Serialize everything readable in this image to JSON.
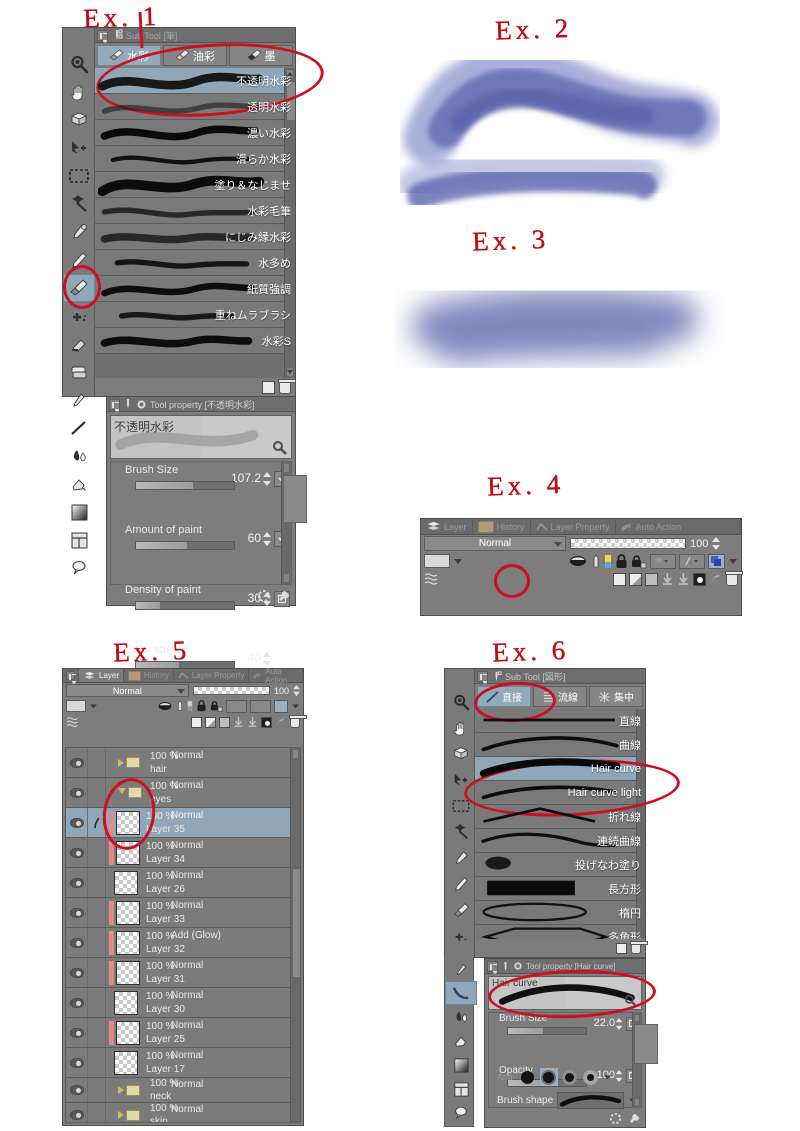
{
  "app": "Clip Studio Paint",
  "annotations": [
    {
      "id": "ex1",
      "text": "Ex. 1"
    },
    {
      "id": "ex2",
      "text": "Ex. 2"
    },
    {
      "id": "ex3",
      "text": "Ex. 3"
    },
    {
      "id": "ex4",
      "text": "Ex. 4"
    },
    {
      "id": "ex5",
      "text": "Ex. 5"
    },
    {
      "id": "ex6",
      "text": "Ex. 6"
    }
  ],
  "colors": {
    "panel_bg": "#7d7d7d",
    "panel_border": "#4e4e4e",
    "selection_blue": "#8fa7b8",
    "annotation_red": "#cc1020",
    "brush_stroke_blue": "#6670b5",
    "layer_red_marker": "#e08a8a"
  },
  "ex1": {
    "subtool_panel": {
      "title": "Sub Tool [筆]",
      "categories": [
        {
          "label": "水彩",
          "icon": "brush-water-icon",
          "active": true
        },
        {
          "label": "油彩",
          "icon": "brush-oil-icon",
          "active": false
        },
        {
          "label": "墨",
          "icon": "brush-ink-icon",
          "active": false
        }
      ],
      "items": [
        {
          "label": "不透明水彩",
          "selected": true
        },
        {
          "label": "透明水彩",
          "selected": false
        },
        {
          "label": "濃い水彩",
          "selected": false
        },
        {
          "label": "滑らか水彩",
          "selected": false
        },
        {
          "label": "塗り＆なじませ",
          "selected": false
        },
        {
          "label": "水彩毛筆",
          "selected": false
        },
        {
          "label": "にじみ縁水彩",
          "selected": false
        },
        {
          "label": "水多め",
          "selected": false
        },
        {
          "label": "紙質強調",
          "selected": false
        },
        {
          "label": "重ねムラブラシ",
          "selected": false
        },
        {
          "label": "水彩S",
          "selected": false
        }
      ]
    },
    "tool_property": {
      "title": "Tool property [不透明水彩]",
      "preview_label": "不透明水彩",
      "rows": [
        {
          "name": "Brush Size",
          "value": "107.2",
          "fill": 58,
          "button": "down-arrow-round-icon"
        },
        {
          "name": "Amount of paint",
          "value": "60",
          "fill": 52,
          "button": "down-arrow-round-icon"
        },
        {
          "name": "Density of paint",
          "value": "30",
          "fill": 24,
          "button": "square-icon"
        },
        {
          "name": "Color stretch",
          "value": "40",
          "fill": 44,
          "button": ""
        }
      ]
    },
    "toolbar_icons": [
      "magnifier-icon",
      "hand-icon",
      "rotate-canvas-icon",
      "move-layer-icon",
      "marquee-icon",
      "magic-wand-icon",
      "eyedropper-icon",
      "pen-icon",
      "brush-icon",
      "airbrush-icon",
      "eraser-icon",
      "blend-icon",
      "eyedropper2-icon",
      "figure-icon",
      "fill-icon",
      "gradient-icon",
      "frame-icon",
      "balloon-icon",
      "decoration-icon"
    ]
  },
  "ex2": {
    "caption": "Ex. 2",
    "stroke_color": "#6670b5"
  },
  "ex3": {
    "caption": "Ex. 3",
    "stroke_color": "#5d68ab"
  },
  "ex4": {
    "tabs": [
      {
        "label": "Layer",
        "icon": "layer-icon",
        "active": true
      },
      {
        "label": "History",
        "icon": "history-icon",
        "active": false
      },
      {
        "label": "Layer Property",
        "icon": "layer-property-icon",
        "active": false
      },
      {
        "label": "Auto Action",
        "icon": "auto-action-icon",
        "active": false
      }
    ],
    "blend_mode": "Normal",
    "opacity": "100",
    "row2_icons": [
      "color-swatch-dropdown",
      "clip-to-layer-icon",
      "mask-icon",
      "ruler-icon",
      "lock-icon",
      "lock-transparent-icon",
      "reference-layer-icon",
      "draft-layer-icon",
      "palette-color-icon"
    ],
    "row3_icons": [
      "new-raster-layer-icon",
      "new-tonal-layer-icon",
      "new-folder-icon",
      "transfer-down-icon",
      "combine-down-icon",
      "layer-mask-icon",
      "clip-icon",
      "delete-layer-icon"
    ],
    "highlighted_icon": "clip-to-layer-below-icon"
  },
  "ex5": {
    "tabs": [
      {
        "label": "Layer",
        "active": true
      },
      {
        "label": "History",
        "active": false
      },
      {
        "label": "Layer Property",
        "active": false
      },
      {
        "label": "Auto Action",
        "active": false
      }
    ],
    "blend_mode": "Normal",
    "opacity": "100",
    "layers": [
      {
        "opacity": "100 %",
        "blend": "Normal",
        "name": "hair",
        "type": "folder",
        "expanded": false,
        "selected": false,
        "red_marker": false
      },
      {
        "opacity": "100 %",
        "blend": "Normal",
        "name": "eyes",
        "type": "folder",
        "expanded": true,
        "selected": false,
        "red_marker": false
      },
      {
        "opacity": "100 %",
        "blend": "Normal",
        "name": "Layer 35",
        "type": "raster",
        "selected": true,
        "red_marker": true,
        "indent": true,
        "has_pen": true
      },
      {
        "opacity": "100 %",
        "blend": "Normal",
        "name": "Layer 34",
        "type": "raster",
        "selected": false,
        "red_marker": true,
        "indent": true
      },
      {
        "opacity": "100 %",
        "blend": "Normal",
        "name": "Layer 26",
        "type": "raster",
        "selected": false,
        "red_marker": false,
        "indent": true
      },
      {
        "opacity": "100 %",
        "blend": "Normal",
        "name": "Layer 33",
        "type": "raster",
        "selected": false,
        "red_marker": true,
        "indent": true
      },
      {
        "opacity": "100 %",
        "blend": "Add (Glow)",
        "name": "Layer 32",
        "type": "raster",
        "selected": false,
        "red_marker": true,
        "indent": true
      },
      {
        "opacity": "100 %",
        "blend": "Normal",
        "name": "Layer 31",
        "type": "raster",
        "selected": false,
        "red_marker": true,
        "indent": true
      },
      {
        "opacity": "100 %",
        "blend": "Normal",
        "name": "Layer 30",
        "type": "raster",
        "selected": false,
        "red_marker": false,
        "indent": true
      },
      {
        "opacity": "100 %",
        "blend": "Normal",
        "name": "Layer 25",
        "type": "raster",
        "selected": false,
        "red_marker": true,
        "indent": true
      },
      {
        "opacity": "100 %",
        "blend": "Normal",
        "name": "Layer 17",
        "type": "raster",
        "selected": false,
        "red_marker": false,
        "indent": true
      },
      {
        "opacity": "100 %",
        "blend": "Normal",
        "name": "neck",
        "type": "folder",
        "expanded": false,
        "selected": false,
        "red_marker": false
      },
      {
        "opacity": "100 %",
        "blend": "Normal",
        "name": "skin",
        "type": "folder",
        "expanded": false,
        "selected": false,
        "red_marker": false
      }
    ]
  },
  "ex6": {
    "subtool_panel": {
      "title": "Sub Tool [図形]",
      "categories": [
        {
          "label": "直接",
          "icon": "straight-line-icon",
          "active": true
        },
        {
          "label": "流線",
          "icon": "flow-line-icon",
          "active": false
        },
        {
          "label": "集中",
          "icon": "focus-line-icon",
          "active": false
        }
      ],
      "items": [
        {
          "label": "直線",
          "selected": false
        },
        {
          "label": "曲線",
          "selected": false
        },
        {
          "label": "Hair curve",
          "selected": true
        },
        {
          "label": "Hair curve light",
          "selected": false
        },
        {
          "label": "折れ線",
          "selected": false
        },
        {
          "label": "連続曲線",
          "selected": false
        },
        {
          "label": "投げなわ塗り",
          "selected": false
        },
        {
          "label": "長方形",
          "selected": false
        },
        {
          "label": "楕円",
          "selected": false
        },
        {
          "label": "多角形",
          "selected": false
        }
      ]
    },
    "tool_property": {
      "title": "Tool property [Hair curve]",
      "preview_label": "Hair curve",
      "rows": [
        {
          "name": "Brush Size",
          "value": "22.0",
          "fill": 45,
          "button": "square-icon"
        },
        {
          "name": "Opacity",
          "value": "100",
          "fill": 60,
          "button": "square-icon"
        }
      ],
      "antialias_label": "Anti-",
      "brush_shape_label": "Brush shape"
    }
  }
}
